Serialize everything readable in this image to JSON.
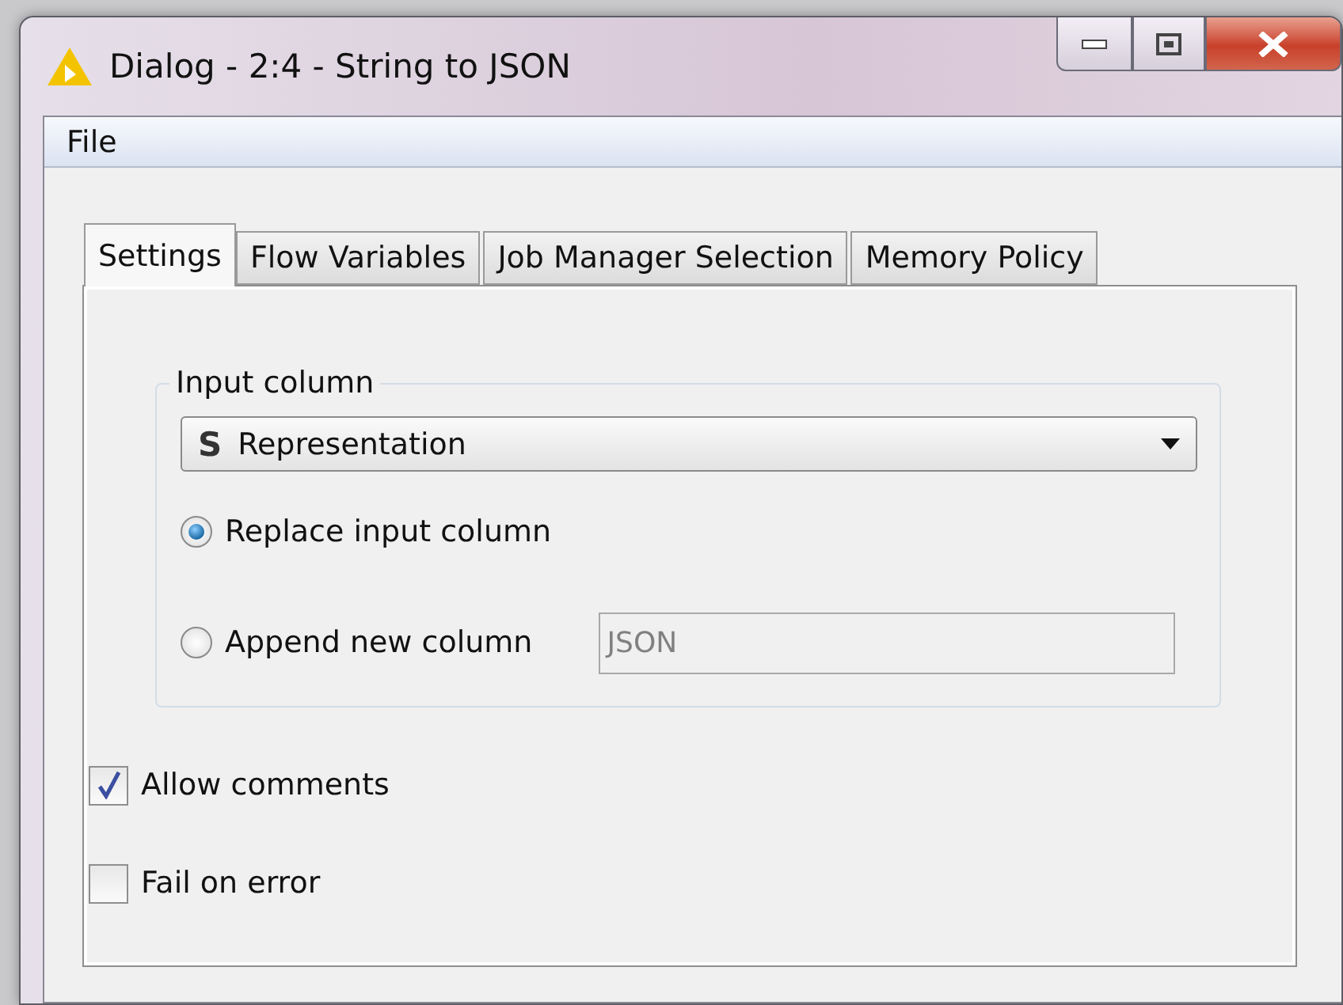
{
  "window": {
    "title": "Dialog - 2:4 - String to JSON"
  },
  "menu": [
    "File"
  ],
  "tabs": [
    {
      "label": "Settings",
      "selected": true
    },
    {
      "label": "Flow Variables",
      "selected": false
    },
    {
      "label": "Job Manager Selection",
      "selected": false
    },
    {
      "label": "Memory Policy",
      "selected": false
    }
  ],
  "input_column": {
    "legend": "Input column",
    "type_badge": "S",
    "value": "Representation"
  },
  "output_options": [
    {
      "kind": "radio",
      "label": "Replace input column",
      "selected": true
    },
    {
      "kind": "radio_field",
      "label": "Append new column",
      "selected": false,
      "field_value": "JSON",
      "disabled": true
    }
  ],
  "checkboxes": [
    {
      "label": "Allow comments",
      "checked": true
    },
    {
      "label": "Fail on error",
      "checked": false
    }
  ]
}
